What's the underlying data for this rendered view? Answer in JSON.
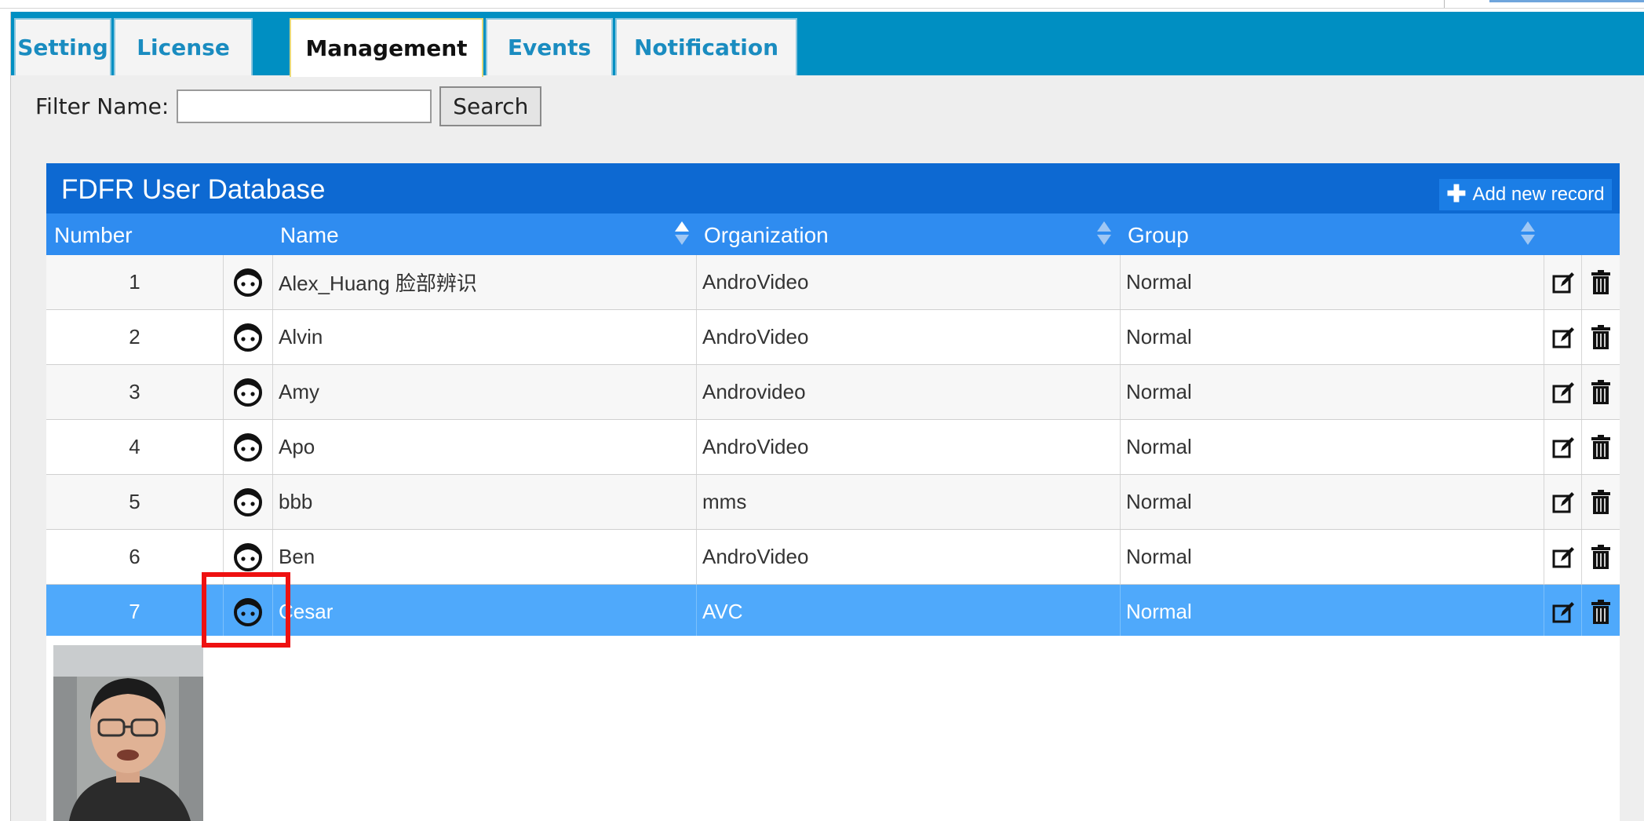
{
  "tabs": [
    {
      "label": "Setting",
      "active": false
    },
    {
      "label": "License",
      "active": false
    },
    {
      "label": "Management",
      "active": true
    },
    {
      "label": "Events",
      "active": false
    },
    {
      "label": "Notification",
      "active": false
    }
  ],
  "filter": {
    "label": "Filter Name:",
    "value": "",
    "search_label": "Search"
  },
  "database": {
    "title": "FDFR User Database",
    "add_label": "Add new record",
    "columns": {
      "number": "Number",
      "name": "Name",
      "organization": "Organization",
      "group": "Group"
    },
    "rows": [
      {
        "number": "1",
        "name": "Alex_Huang 脸部辨识",
        "organization": "AndroVideo",
        "group": "Normal"
      },
      {
        "number": "2",
        "name": "Alvin",
        "organization": "AndroVideo",
        "group": "Normal"
      },
      {
        "number": "3",
        "name": "Amy",
        "organization": "Androvideo",
        "group": "Normal"
      },
      {
        "number": "4",
        "name": "Apo",
        "organization": "AndroVideo",
        "group": "Normal"
      },
      {
        "number": "5",
        "name": "bbb",
        "organization": "mms",
        "group": "Normal"
      },
      {
        "number": "6",
        "name": "Ben",
        "organization": "AndroVideo",
        "group": "Normal"
      },
      {
        "number": "7",
        "name": "Cesar",
        "organization": "AVC",
        "group": "Normal",
        "selected": true
      }
    ]
  },
  "icons": {
    "face": "face-icon",
    "edit": "edit-icon",
    "delete": "trash-icon",
    "add": "plus-icon",
    "sort": "sort-icon"
  },
  "colors": {
    "tabbar": "#008fc2",
    "title_bar": "#0d69d2",
    "header_row": "#2f8cf0",
    "selected_row": "#4fa9fb",
    "highlight": "#ee1111"
  }
}
